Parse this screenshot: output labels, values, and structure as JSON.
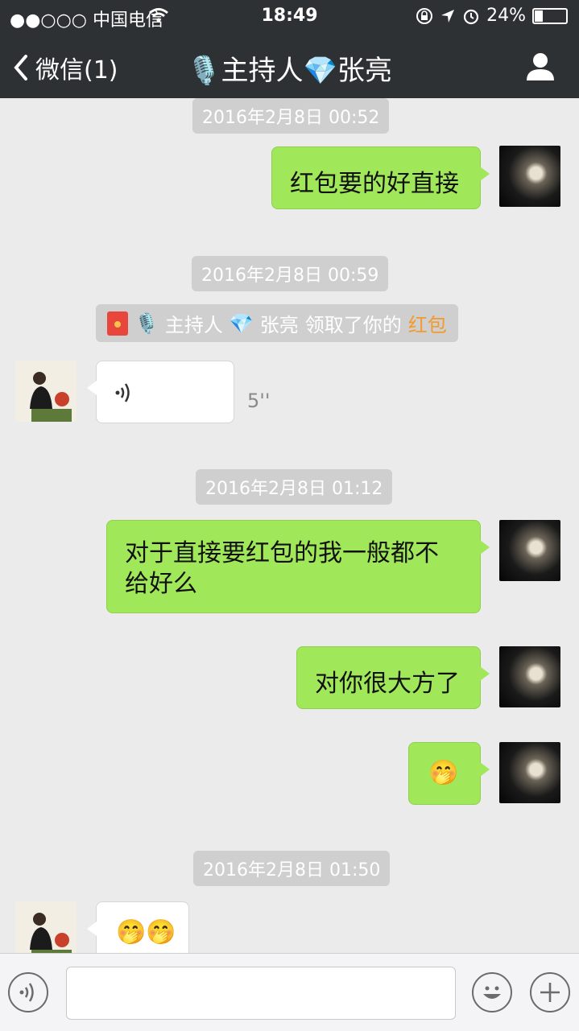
{
  "status": {
    "carrier": "●●○○○ 中国电信",
    "time": "18:49",
    "battery": "24%",
    "battery_level": 0.24
  },
  "nav": {
    "back_label": "微信(1)",
    "title": "🎙️主持人💎张亮",
    "title_parts": {
      "emoji1": "🎙️",
      "name_a": "主持人",
      "emoji2": "💎",
      "name_b": "张亮"
    }
  },
  "messages": {
    "ts1": "2016年2月8日 00:52",
    "msg1": "红包要的好直接",
    "ts2": "2016年2月8日 00:59",
    "system": {
      "mic": "🎙️",
      "name_a": "主持人",
      "gem": "💎",
      "name_b": "张亮",
      "text": "领取了你的",
      "link": "红包"
    },
    "voice_duration": "5''",
    "ts3": "2016年2月8日 01:12",
    "msg2": "对于直接要红包的我一般都不给好么",
    "msg3": "对你很大方了",
    "msg4": "🤭",
    "ts4": "2016年2月8日 01:50",
    "msg5": "🤭🤭"
  },
  "colors": {
    "bar": "#2e3133",
    "background": "#ebebeb",
    "bubble_sent": "#a0e75a",
    "bubble_received": "#ffffff",
    "link": "#f39a2f"
  },
  "icons": [
    "back-chevron-icon",
    "user-profile-icon",
    "red-packet-icon",
    "voice-wave-icon",
    "voice-input-icon",
    "emoji-icon",
    "plus-icon"
  ]
}
